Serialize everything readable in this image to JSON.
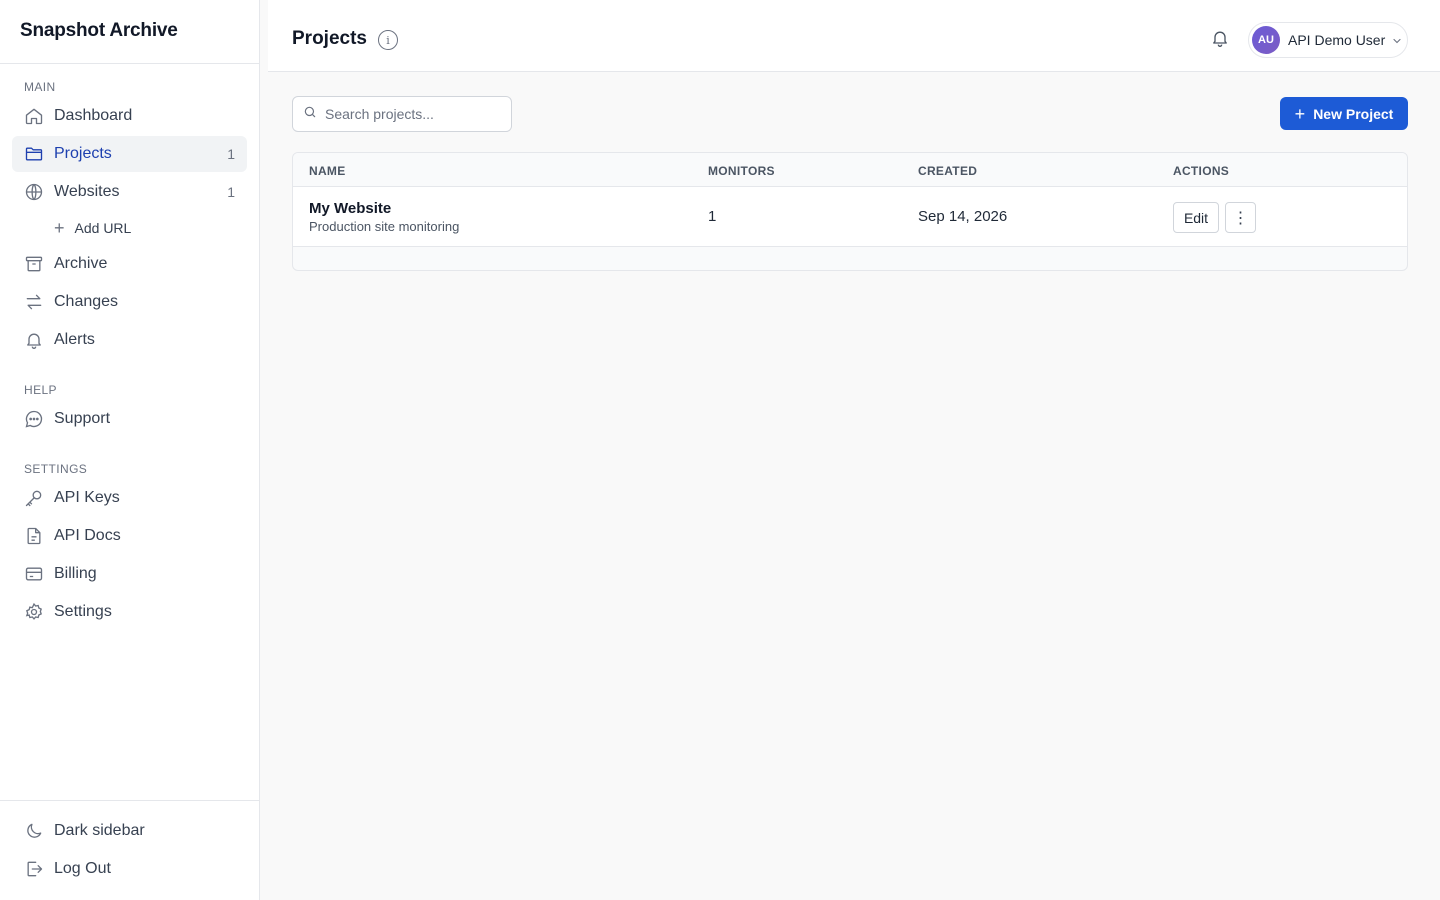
{
  "app": {
    "title": "Snapshot Archive"
  },
  "sidebar": {
    "sections": {
      "main": "MAIN",
      "help": "HELP",
      "settings": "SETTINGS"
    },
    "items": {
      "dashboard": {
        "label": "Dashboard",
        "icon": "home-icon"
      },
      "projects": {
        "label": "Projects",
        "icon": "folder-icon",
        "count": "1",
        "active": true
      },
      "websites": {
        "label": "Websites",
        "icon": "globe-icon",
        "count": "1"
      },
      "add_url": {
        "label": "Add URL",
        "icon": "plus-icon"
      },
      "archive": {
        "label": "Archive",
        "icon": "archive-icon"
      },
      "changes": {
        "label": "Changes",
        "icon": "swap-arrows-icon"
      },
      "alerts": {
        "label": "Alerts",
        "icon": "bell-icon"
      },
      "support": {
        "label": "Support",
        "icon": "chat-icon"
      },
      "api_keys": {
        "label": "API Keys",
        "icon": "key-icon"
      },
      "api_docs": {
        "label": "API Docs",
        "icon": "document-icon"
      },
      "billing": {
        "label": "Billing",
        "icon": "credit-card-icon"
      },
      "settings": {
        "label": "Settings",
        "icon": "gear-icon"
      }
    },
    "footer": {
      "dark_sidebar": {
        "label": "Dark sidebar",
        "icon": "moon-icon"
      },
      "log_out": {
        "label": "Log Out",
        "icon": "logout-icon"
      }
    }
  },
  "header": {
    "title": "Projects",
    "info_icon": "info-icon",
    "notifications_icon": "bell-icon",
    "user": {
      "initials": "AU",
      "name": "API Demo User"
    }
  },
  "toolbar": {
    "search_placeholder": "Search projects...",
    "new_project_label": "New Project"
  },
  "table": {
    "columns": [
      "NAME",
      "MONITORS",
      "CREATED",
      "ACTIONS"
    ],
    "rows": [
      {
        "name": "My Website",
        "description": "Production site monitoring",
        "monitors": "1",
        "created": "Sep 14, 2026",
        "edit_label": "Edit",
        "more_label": "⋮"
      }
    ]
  },
  "colors": {
    "accent": "#1d5bd6",
    "active_text": "#1e40af",
    "avatar": "#6b5bd6"
  }
}
